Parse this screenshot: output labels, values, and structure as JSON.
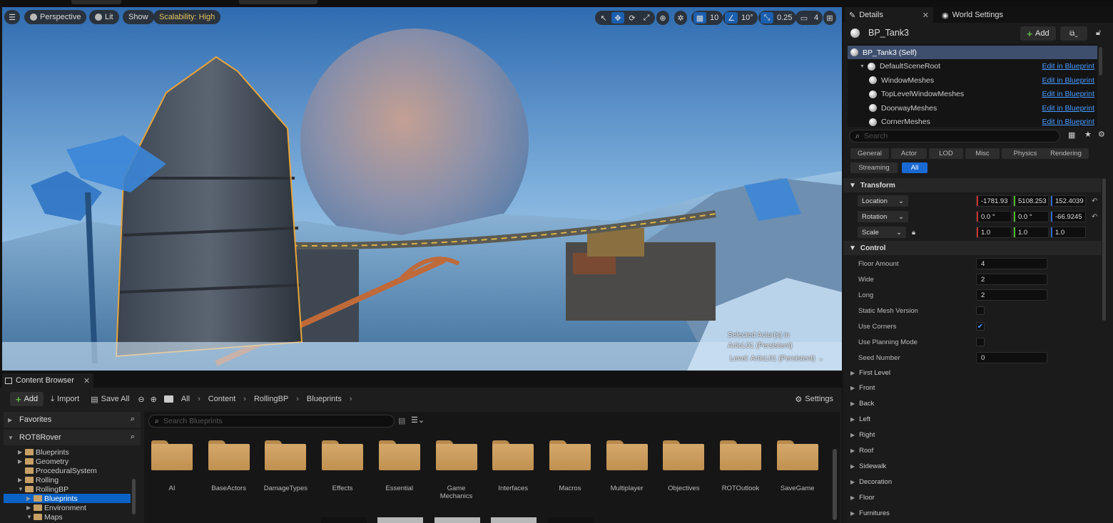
{
  "viewport": {
    "menu_icon": "hamburger-icon",
    "view_mode": "Perspective",
    "lighting": "Lit",
    "show_label": "Show",
    "scalability": "Scalability: High",
    "grid_snap": "10",
    "rotation_snap": "10°",
    "scale_snap": "0.25",
    "camera_speed": "4",
    "selected_actor_text": "Selected Actor(s) in",
    "selected_actor_level": "ArticL01 (Persistent)",
    "level_text": "Level:  ArticL01 (Persistent)"
  },
  "content_browser": {
    "tab_title": "Content Browser",
    "toolbar": {
      "add": "Add",
      "import": "Import",
      "save_all": "Save All",
      "settings": "Settings"
    },
    "breadcrumb": [
      "All",
      "Content",
      "RollingBP",
      "Blueprints"
    ],
    "search_placeholder": "Search Blueprints",
    "favorites": "Favorites",
    "project": "ROT8Rover",
    "tree": [
      {
        "label": "Blueprints",
        "indent": 1,
        "expandable": true,
        "selected": false
      },
      {
        "label": "Geometry",
        "indent": 1,
        "expandable": true,
        "selected": false
      },
      {
        "label": "ProceduralSystem",
        "indent": 1,
        "expandable": false,
        "selected": false
      },
      {
        "label": "Rolling",
        "indent": 1,
        "expandable": true,
        "selected": false
      },
      {
        "label": "RollingBP",
        "indent": 1,
        "expandable": true,
        "expanded": true,
        "selected": false
      },
      {
        "label": "Blueprints",
        "indent": 2,
        "expandable": true,
        "selected": true
      },
      {
        "label": "Environment",
        "indent": 2,
        "expandable": true,
        "selected": false
      },
      {
        "label": "Maps",
        "indent": 2,
        "expandable": true,
        "expanded": true,
        "selected": false
      }
    ],
    "assets": [
      "AI",
      "BaseActors",
      "DamageTypes",
      "Effects",
      "Essential",
      "Game Mechanics",
      "Interfaces",
      "Macros",
      "Multiplayer",
      "Objectives",
      "ROTOutlook",
      "SaveGame"
    ]
  },
  "details": {
    "tab_details": "Details",
    "tab_world": "World Settings",
    "actor_name": "BP_Tank3",
    "add_label": "Add",
    "components": [
      {
        "label": "BP_Tank3 (Self)",
        "indent": 0,
        "selected": true,
        "link": ""
      },
      {
        "label": "DefaultSceneRoot",
        "indent": 1,
        "selected": false,
        "link": "Edit in Blueprint"
      },
      {
        "label": "WindowMeshes",
        "indent": 2,
        "selected": false,
        "link": "Edit in Blueprint"
      },
      {
        "label": "TopLevelWindowMeshes",
        "indent": 2,
        "selected": false,
        "link": "Edit in Blueprint"
      },
      {
        "label": "DoorwayMeshes",
        "indent": 2,
        "selected": false,
        "link": "Edit in Blueprint"
      },
      {
        "label": "CornerMeshes",
        "indent": 2,
        "selected": false,
        "link": "Edit in Blueprint"
      }
    ],
    "search_placeholder": "Search",
    "filters": [
      {
        "label": "General",
        "active": false
      },
      {
        "label": "Actor",
        "active": false
      },
      {
        "label": "LOD",
        "active": false
      },
      {
        "label": "Misc",
        "active": false
      },
      {
        "label": "Physics",
        "active": false
      },
      {
        "label": "Rendering",
        "active": false
      },
      {
        "label": "Streaming",
        "active": false
      },
      {
        "label": "All",
        "active": true
      }
    ],
    "transform": {
      "header": "Transform",
      "location_label": "Location",
      "location": [
        "-1781.93",
        "5108.253",
        "152.4039"
      ],
      "rotation_label": "Rotation",
      "rotation": [
        "0.0 °",
        "0.0 °",
        "-66.9245"
      ],
      "scale_label": "Scale",
      "scale": [
        "1.0",
        "1.0",
        "1.0"
      ]
    },
    "control": {
      "header": "Control",
      "floor_amount_label": "Floor Amount",
      "floor_amount": "4",
      "wide_label": "Wide",
      "wide": "2",
      "long_label": "Long",
      "long": "2",
      "static_mesh_label": "Static Mesh Version",
      "static_mesh": false,
      "use_corners_label": "Use Corners",
      "use_corners": true,
      "use_planning_label": "Use Planning Mode",
      "use_planning": false,
      "seed_label": "Seed Number",
      "seed": "0"
    },
    "collapsed_sections": [
      "First Level",
      "Front",
      "Back",
      "Left",
      "Right",
      "Roof",
      "Sidewalk",
      "Decoration",
      "Floor",
      "Furnitures"
    ]
  },
  "colors": {
    "accent_blue": "#0a62c5",
    "selection_yellow": "#e8a43a",
    "folder": "#c8a065",
    "link": "#4a9cff"
  }
}
